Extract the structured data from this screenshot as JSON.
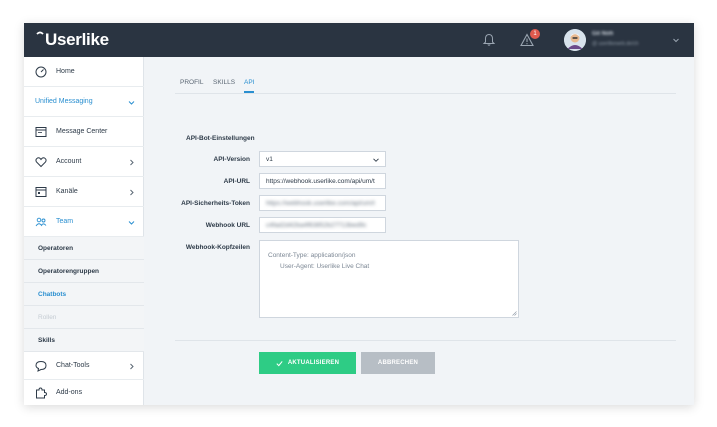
{
  "header": {
    "logo_text": "Userlike",
    "notification_badge": "1",
    "user_name": "Gil Noh",
    "user_subtitle": "@ userlikeweb.de/ch"
  },
  "sidebar": {
    "items": [
      {
        "label": "Home",
        "icon": "speedometer-icon"
      },
      {
        "label": "Unified Messaging",
        "icon": "none"
      },
      {
        "label": "Message Center",
        "icon": "message-center-icon"
      },
      {
        "label": "Account",
        "icon": "heart-icon"
      },
      {
        "label": "Kanäle",
        "icon": "channels-icon"
      },
      {
        "label": "Team",
        "icon": "team-icon"
      },
      {
        "label": "Chat-Tools",
        "icon": "chat-bubble-icon"
      },
      {
        "label": "Add-ons",
        "icon": "puzzle-icon"
      }
    ],
    "team_sub_items": [
      "Operatoren",
      "Operatorengruppen",
      "Chatbots",
      "Rollen",
      "Skills"
    ]
  },
  "tabs": [
    "PROFIL",
    "SKILLS",
    "API"
  ],
  "form": {
    "section_title": "API-Bot-Einstellungen",
    "api_version_label": "API-Version",
    "api_version_value": "v1",
    "api_url_label": "API-URL",
    "api_url_value": "https://webhook.userlike.com/api/um/t",
    "token_label": "API-Sicherheits-Token",
    "token_value": "https://webhook.userlike.com/api/um/t",
    "webhook_url_label": "Webhook URL",
    "webhook_url_value": "c4fad2d42ba4f63852b27713bed9c",
    "headers_label": "Webhook-Kopfzeilen",
    "headers_line1": "Content-Type: application/json",
    "headers_line2": "User-Agent: Userlike Live Chat"
  },
  "buttons": {
    "update_label": "AKTUALISIEREN",
    "cancel_label": "ABBRECHEN"
  },
  "colors": {
    "topbar": "#2a3441",
    "accent_blue": "#2a8fd0",
    "primary_green": "#2ecc85",
    "disabled_gray": "#b7bec5",
    "badge_red": "#e05a4e"
  }
}
